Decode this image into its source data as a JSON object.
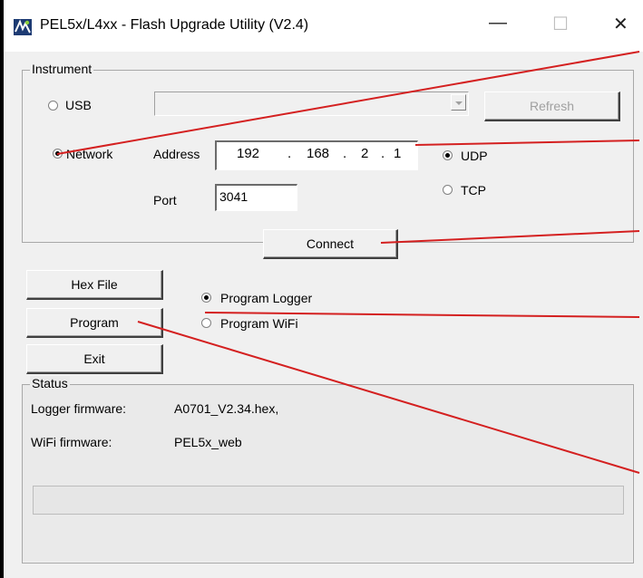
{
  "window": {
    "title": "PEL5x/L4xx - Flash Upgrade Utility (V2.4)",
    "min_glyph": "—",
    "max_glyph": "☐",
    "close_glyph": "✕"
  },
  "instrument": {
    "legend": "Instrument",
    "usb_label": "USB",
    "usb_selected": false,
    "usb_combo_value": "",
    "refresh_label": "Refresh",
    "network_label": "Network",
    "network_selected": true,
    "address_label": "Address",
    "ip_octets": [
      "192",
      "168",
      "2",
      "1"
    ],
    "ip_dot": ".",
    "port_label": "Port",
    "port_value": "3041",
    "udp_label": "UDP",
    "udp_selected": true,
    "tcp_label": "TCP",
    "tcp_selected": false,
    "connect_label": "Connect"
  },
  "actions": {
    "hex_file_label": "Hex File",
    "program_label": "Program",
    "exit_label": "Exit",
    "program_logger_label": "Program Logger",
    "program_logger_selected": true,
    "program_wifi_label": "Program WiFi",
    "program_wifi_selected": false
  },
  "status": {
    "legend": "Status",
    "logger_firmware_label": "Logger firmware:",
    "logger_firmware_value": "A0701_V2.34.hex,",
    "wifi_firmware_label": "WiFi firmware:",
    "wifi_firmware_value": "PEL5x_web",
    "progress_value": 0
  },
  "annotation_color": "#d42020"
}
